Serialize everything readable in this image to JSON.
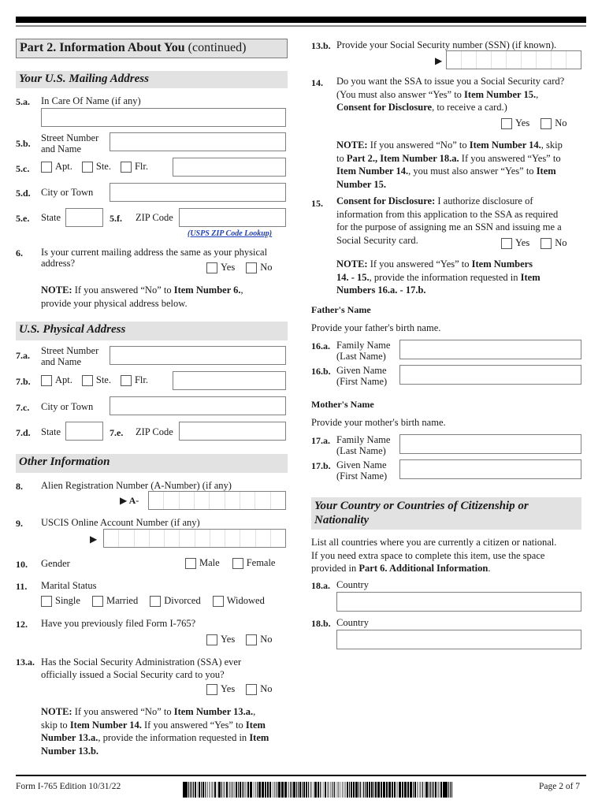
{
  "header": {
    "part_bold": "Part 2.  Information About You",
    "part_rest": " (continued)"
  },
  "mailing": {
    "title": "Your U.S. Mailing Address",
    "in_care_num": "5.a.",
    "in_care_label": "In Care Of Name (if any)",
    "street_num": "5.b.",
    "street_label_1": "Street Number",
    "street_label_2": "and Name",
    "unit_num": "5.c.",
    "apt": "Apt.",
    "ste": "Ste.",
    "flr": "Flr.",
    "city_num": "5.d.",
    "city_label": "City or Town",
    "state_num": "5.e.",
    "state_label": "State",
    "zip_num": "5.f.",
    "zip_label": "ZIP Code",
    "zip_link": "(USPS ZIP Code Lookup)",
    "q6_num": "6.",
    "q6_text_1": "Is your current mailing address the same as your physical",
    "q6_text_2": "address?",
    "note_bold": "NOTE:",
    "note_1": "  If you answered “No” to ",
    "note_item": "Item Number 6.",
    "note_2": ",",
    "note_3": "provide your physical address below."
  },
  "physical": {
    "title": "U.S. Physical Address",
    "street_num": "7.a.",
    "street_label_1": "Street Number",
    "street_label_2": "and Name",
    "unit_num": "7.b.",
    "apt": "Apt.",
    "ste": "Ste.",
    "flr": "Flr.",
    "city_num": "7.c.",
    "city_label": "City or Town",
    "state_num": "7.d.",
    "state_label": "State",
    "zip_num": "7.e.",
    "zip_label": "ZIP Code"
  },
  "other": {
    "title": "Other Information",
    "q8_num": "8.",
    "q8_label": "Alien Registration Number (A-Number) (if any)",
    "q8_prefix": "A-",
    "q9_num": "9.",
    "q9_label": "USCIS Online Account Number (if any)",
    "q10_num": "10.",
    "q10_label": "Gender",
    "male": "Male",
    "female": "Female",
    "q11_num": "11.",
    "q11_label": "Marital Status",
    "single": "Single",
    "married": "Married",
    "divorced": "Divorced",
    "widowed": "Widowed",
    "q12_num": "12.",
    "q12_label": "Have you previously filed Form I-765?",
    "q13a_num": "13.a.",
    "q13a_label_1": "Has the Social Security Administration (SSA) ever",
    "q13a_label_2": "officially issued a Social Security card to you?",
    "note13_l1a": "NOTE:",
    "note13_l1b": "  If you answered “No” to ",
    "note13_l1c": "Item Number 13.a.",
    "note13_l1d": ",",
    "note13_l2a": "skip to ",
    "note13_l2b": "Item Number 14.",
    "note13_l2c": "  If you answered “Yes” to ",
    "note13_l2d": "Item",
    "note13_l3a": "Number 13.a.",
    "note13_l3b": ", provide the information requested in ",
    "note13_l3c": "Item",
    "note13_l4": "Number 13.b."
  },
  "common": {
    "yes": "Yes",
    "no": "No",
    "arrow": "▶"
  },
  "right": {
    "q13b_num": "13.b.",
    "q13b_label": "Provide your Social Security number (SSN) (if known).",
    "q14_num": "14.",
    "q14_l1": "Do you want the SSA to issue you a Social Security card?",
    "q14_l2a": "(You must also answer “Yes” to ",
    "q14_l2b": "Item Number 15.",
    "q14_l2c": ",",
    "q14_l3a": "Consent for Disclosure",
    "q14_l3b": ", to receive a card.)",
    "n14_l1a": "NOTE:",
    "n14_l1b": "  If you answered “No” to ",
    "n14_l1c": "Item Number 14.",
    "n14_l1d": ", skip",
    "n14_l2a": "to ",
    "n14_l2b": "Part 2., Item Number 18.a.",
    "n14_l2c": "  If you answered “Yes” to",
    "n14_l3a": "Item Number 14.",
    "n14_l3b": ", you must also answer “Yes” to ",
    "n14_l3c": "Item",
    "n14_l4": "Number 15.",
    "q15_num": "15.",
    "q15_l1a": "Consent for Disclosure:",
    "q15_l1b": "  I authorize disclosure of",
    "q15_l2": "information from this application to the SSA as required",
    "q15_l3": "for the purpose of assigning me an SSN and issuing me a",
    "q15_l4": "Social Security card.",
    "n15_l1a": "NOTE:",
    "n15_l1b": "  If you answered “Yes” to ",
    "n15_l1c": "Item Numbers",
    "n15_l2a": "14. - 15.",
    "n15_l2b": ", provide the information requested in ",
    "n15_l2c": "Item",
    "n15_l3": "Numbers 16.a. - 17.b.",
    "father_title": "Father's Name",
    "father_desc": "Provide your father's birth name.",
    "q16a_num": "16.a.",
    "q16b_num": "16.b.",
    "mother_title": "Mother's Name",
    "mother_desc": "Provide your mother's birth name.",
    "q17a_num": "17.a.",
    "q17b_num": "17.b.",
    "family_1": "Family Name",
    "family_2": "(Last Name)",
    "given_1": "Given Name",
    "given_2": "(First Name)",
    "citizen_title_1": "Your Country or Countries of Citizenship or",
    "citizen_title_2": "Nationality",
    "cit_l1": "List all countries where you are currently a citizen or national.",
    "cit_l2": "If you need extra space to complete this item, use the space",
    "cit_l3a": "provided in ",
    "cit_l3b": "Part 6. Additional Information",
    "cit_l3c": ".",
    "q18a_num": "18.a.",
    "q18b_num": "18.b.",
    "country": "Country"
  },
  "footer": {
    "form": "Form I-765   Edition   10/31/22",
    "page": "Page 2 of 7"
  }
}
